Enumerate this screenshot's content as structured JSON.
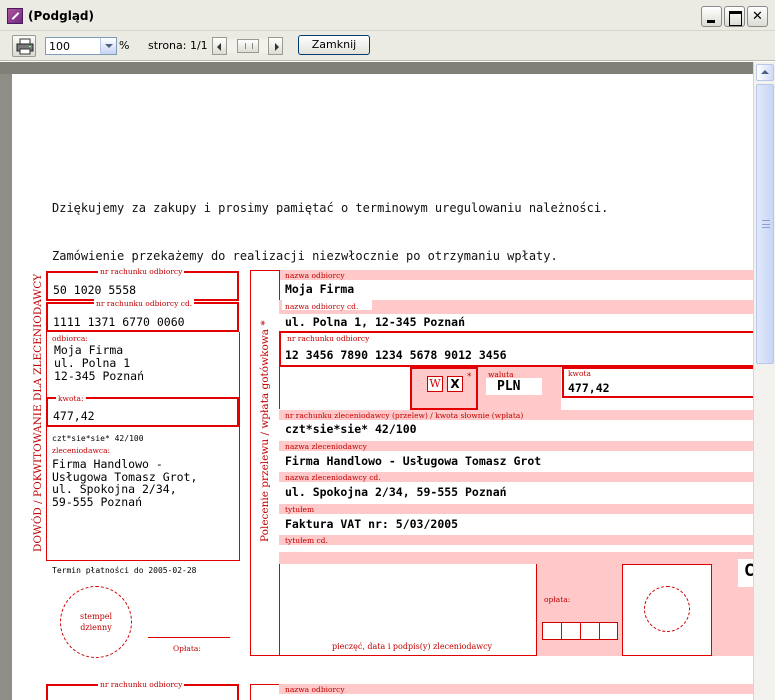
{
  "window": {
    "title": "(Podgląd)"
  },
  "toolbar": {
    "zoom_value": "100",
    "percent": "%",
    "page_label": "strona: 1/1",
    "close_label": "Zamknij"
  },
  "document": {
    "thanks_line1": "Dziękujemy za zakupy i prosimy pamiętać o terminowym uregulowaniu należności.",
    "thanks_line2": "Zamówienie przekażemy do realizacji niezwłocznie po otrzymaniu wpłaty.",
    "stub": {
      "side_text": "DOWÓD / POKWITOWANIE DLA ZLECENIODAWCY",
      "acct_label": "nr rachunku odbiorcy",
      "acct_value": "50 1020 5558",
      "acct_cd_label": "nr rachunku odbiorcy cd.",
      "acct_cd_value": "1111 1371 6770 0060",
      "recipient_label": "odbiorca:",
      "recipient_lines": [
        "Moja Firma",
        "ul. Polna 1",
        "12-345 Poznań"
      ],
      "amount_label": "kwota:",
      "amount_value": "477,42",
      "words_value": "czt*sie*sie* 42/100",
      "payer_label": "zleceniodawca:",
      "payer_lines": [
        "Firma Handlowo -",
        "Usługowa Tomasz Grot,",
        "ul. Spokojna 2/34,",
        "59-555 Poznań"
      ],
      "due_label": "Termin płatności do 2005-02-28",
      "stamp_lines": [
        "stempel",
        "dzienny"
      ],
      "fee_label": "Opłata:"
    },
    "main": {
      "side_text": "Polecenie przelewu / wpłata gotówkowa",
      "side_star": "*",
      "recipient_label": "nazwa odbiorcy",
      "recipient_value": "Moja Firma",
      "recipient_cd_label": "nazwa odbiorcy cd.",
      "recipient_cd_value": "ul. Polna 1, 12-345 Poznań",
      "acct_label": "nr rachunku odbiorcy",
      "acct_value": "12 3456 7890 1234 5678 9012 3456",
      "w_box": "W",
      "x_box": "X",
      "wx_star": "*",
      "currency_label": "waluta",
      "currency_value": "PLN",
      "amount_label": "kwota",
      "amount_value": "477,42",
      "payer_acct_label": "nr rachunku zleceniodawcy (przelew) / kwota słownie (wpłata)",
      "payer_acct_value": "czt*sie*sie* 42/100",
      "payer_label": "nazwa zleceniodawcy",
      "payer_value": "Firma Handlowo - Usługowa Tomasz Grot",
      "payer_cd_label": "nazwa zleceniodawcy cd.",
      "payer_cd_value": "ul. Spokojna 2/34, 59-555 Poznań",
      "title_label": "tytułem",
      "title_value": "Faktura VAT nr: 5/03/2005",
      "title_cd_label": "tytułem cd.",
      "fee_label": "opłata:",
      "signature_label": "pieczęć, data i podpis(y) zleceniodawcy",
      "corner_char": "C"
    },
    "next_copy": {
      "acct_label": "nr rachunku odbiorcy",
      "recipient_label": "nazwa odbiorcy"
    }
  },
  "colors": {
    "form_red": "#e20000",
    "form_pink": "#ffc9c9",
    "toolbar_bg": "#ebeae3"
  }
}
